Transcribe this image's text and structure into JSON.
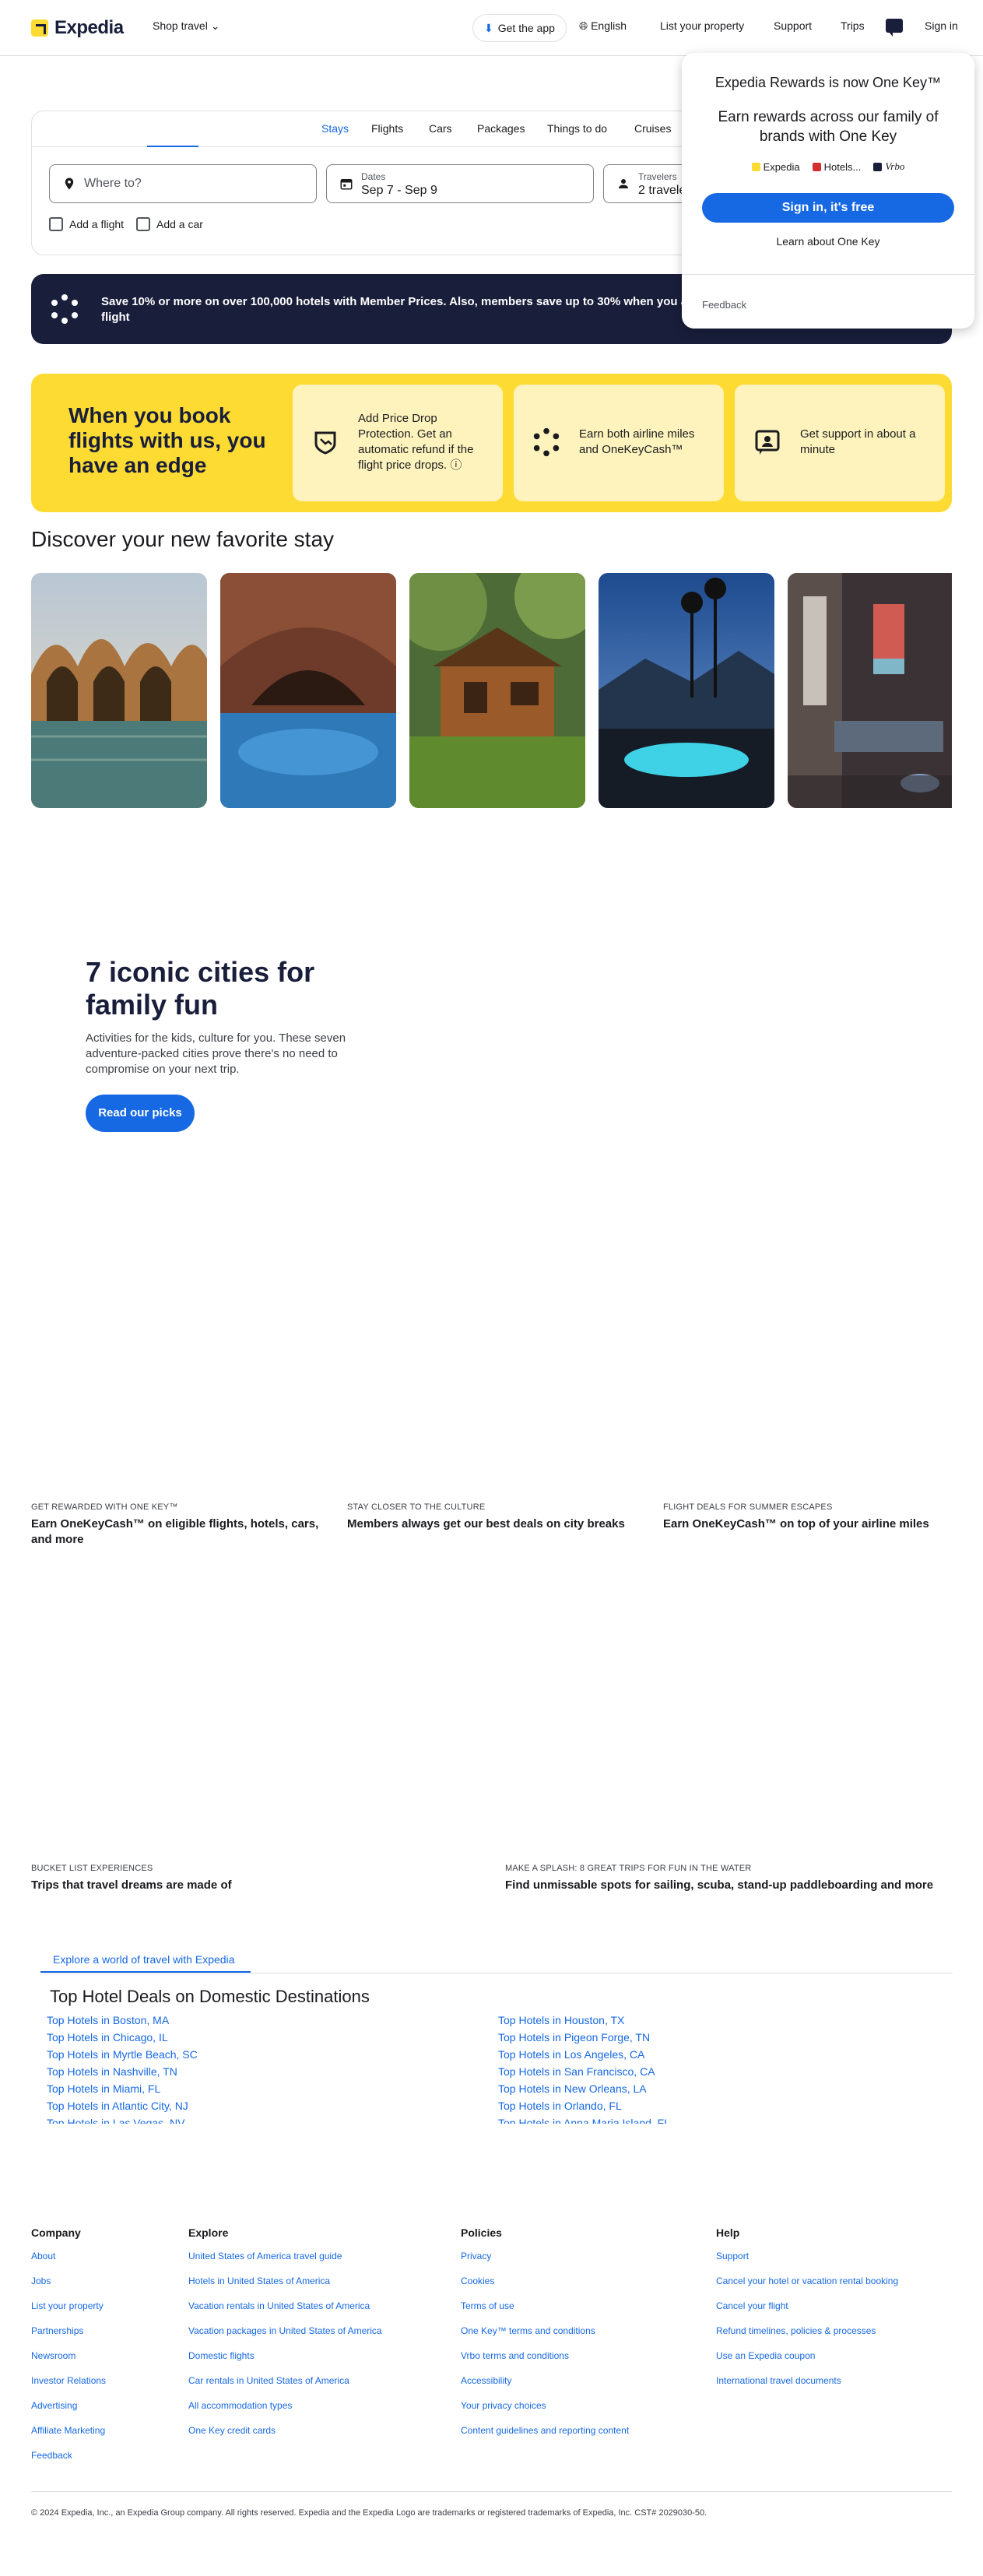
{
  "header": {
    "logo": "Expedia",
    "shop_travel": "Shop travel",
    "get_app": "Get the app",
    "language": "English",
    "list_property": "List your property",
    "support": "Support",
    "trips": "Trips",
    "sign_in": "Sign in"
  },
  "search": {
    "tabs": [
      "Stays",
      "Flights",
      "Cars",
      "Packages",
      "Things to do",
      "Cruises"
    ],
    "active_tab": "Stays",
    "where_placeholder": "Where to?",
    "dates_label": "Dates",
    "dates_value": "Sep 7 - Sep 9",
    "travelers_label": "Travelers",
    "travelers_value": "2 travele",
    "add_flight": "Add a flight",
    "add_car": "Add a car"
  },
  "promo": {
    "text": "Save 10% or more on over 100,000 hotels with Member Prices. Also, members save up to 30% when you add a hotel to a flight"
  },
  "rewards_popup": {
    "title": "Expedia Rewards is now One Key™",
    "subtitle": "Earn rewards across our family of brands with One Key",
    "brands": [
      "Expedia",
      "Hotels...",
      "Vrbo"
    ],
    "sign_in_button": "Sign in, it's free",
    "learn_link": "Learn about One Key",
    "feedback": "Feedback"
  },
  "edge": {
    "title": "When you book flights with us, you have an edge",
    "cards": [
      {
        "text": "Add Price Drop Protection. Get an automatic refund if the flight price drops.",
        "icon": "price-drop-icon"
      },
      {
        "text": "Earn both airline miles and OneKeyCash™",
        "icon": "rewards-icon"
      },
      {
        "text": "Get support in about a minute",
        "icon": "support-icon"
      }
    ]
  },
  "discover": {
    "title": "Discover your new favorite stay"
  },
  "hero": {
    "title": "7 iconic cities for family fun",
    "body": "Activities for the kids, culture for you. These seven adventure-packed cities prove there's no need to compromise on your next trip.",
    "button": "Read our picks"
  },
  "features_row1": [
    {
      "kicker": "GET REWARDED WITH ONE KEY™",
      "title": "Earn OneKeyCash™ on eligible flights, hotels, cars, and more"
    },
    {
      "kicker": "STAY CLOSER TO THE CULTURE",
      "title": "Members always get our best deals on city breaks"
    },
    {
      "kicker": "FLIGHT DEALS FOR SUMMER ESCAPES",
      "title": "Earn OneKeyCash™ on top of your airline miles"
    }
  ],
  "features_row2": [
    {
      "kicker": "BUCKET LIST EXPERIENCES",
      "title": "Trips that travel dreams are made of"
    },
    {
      "kicker": "MAKE A SPLASH: 8 GREAT TRIPS FOR FUN IN THE WATER",
      "title": "Find unmissable spots for sailing, scuba, stand-up paddleboarding and more"
    }
  ],
  "explore": {
    "tab": "Explore a world of travel with Expedia",
    "deals_title": "Top Hotel Deals on Domestic Destinations",
    "left": [
      "Top Hotels in Boston, MA",
      "Top Hotels in Chicago, IL",
      "Top Hotels in Myrtle Beach, SC",
      "Top Hotels in Nashville, TN",
      "Top Hotels in Miami, FL",
      "Top Hotels in Atlantic City, NJ",
      "Top Hotels in Las Vegas, NV"
    ],
    "right": [
      "Top Hotels in Houston, TX",
      "Top Hotels in Pigeon Forge, TN",
      "Top Hotels in Los Angeles, CA",
      "Top Hotels in San Francisco, CA",
      "Top Hotels in New Orleans, LA",
      "Top Hotels in Orlando, FL",
      "Top Hotels in Anna Maria Island, FL"
    ]
  },
  "footer": {
    "company": {
      "title": "Company",
      "links": [
        "About",
        "Jobs",
        "List your property",
        "Partnerships",
        "Newsroom",
        "Investor Relations",
        "Advertising",
        "Affiliate Marketing",
        "Feedback"
      ]
    },
    "explore": {
      "title": "Explore",
      "links": [
        "United States of America travel guide",
        "Hotels in United States of America",
        "Vacation rentals in United States of America",
        "Vacation packages in United States of America",
        "Domestic flights",
        "Car rentals in United States of America",
        "All accommodation types",
        "One Key credit cards"
      ]
    },
    "policies": {
      "title": "Policies",
      "links": [
        "Privacy",
        "Cookies",
        "Terms of use",
        "One Key™ terms and conditions",
        "Vrbo terms and conditions",
        "Accessibility",
        "Your privacy choices",
        "Content guidelines and reporting content"
      ]
    },
    "help": {
      "title": "Help",
      "links": [
        "Support",
        "Cancel your hotel or vacation rental booking",
        "Cancel your flight",
        "Refund timelines, policies & processes",
        "Use an Expedia coupon",
        "International travel documents"
      ]
    },
    "copyright": "© 2024 Expedia, Inc., an Expedia Group company. All rights reserved. Expedia and the Expedia Logo are trademarks or registered trademarks of Expedia, Inc. CST# 2029030-50."
  }
}
